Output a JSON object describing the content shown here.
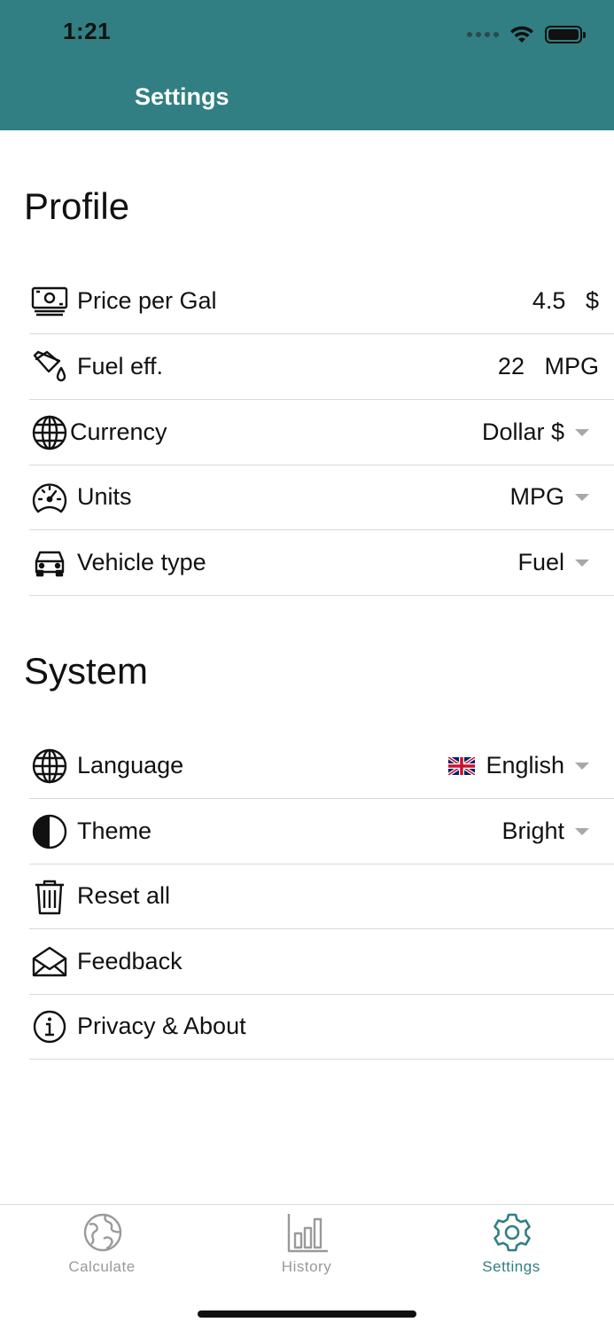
{
  "status_bar": {
    "time": "1:21"
  },
  "header": {
    "title": "Settings",
    "bg_color": "#317F82"
  },
  "profile": {
    "title": "Profile",
    "rows": [
      {
        "icon": "money-icon",
        "label": "Price per Gal",
        "value": "4.5",
        "unit": "$"
      },
      {
        "icon": "fuel-can-icon",
        "label": "Fuel eff.",
        "value": "22",
        "unit": "MPG"
      },
      {
        "icon": "globe-icon",
        "label": "Currency",
        "selected": "Dollar $"
      },
      {
        "icon": "speedometer-icon",
        "label": "Units",
        "selected": "MPG"
      },
      {
        "icon": "car-icon",
        "label": "Vehicle type",
        "selected": "Fuel"
      }
    ]
  },
  "system": {
    "title": "System",
    "rows": [
      {
        "icon": "globe-icon",
        "label": "Language",
        "flag": "uk-flag-icon",
        "selected": "English"
      },
      {
        "icon": "half-circle-icon",
        "label": "Theme",
        "selected": "Bright"
      },
      {
        "icon": "trash-icon",
        "label": "Reset all"
      },
      {
        "icon": "envelope-icon",
        "label": "Feedback"
      },
      {
        "icon": "info-icon",
        "label": "Privacy & About"
      }
    ]
  },
  "tabs": [
    {
      "icon": "earth-icon",
      "label": "Calculate",
      "active": false
    },
    {
      "icon": "bar-chart-icon",
      "label": "History",
      "active": false
    },
    {
      "icon": "gear-icon",
      "label": "Settings",
      "active": true
    }
  ],
  "colors": {
    "accent": "#317F82",
    "inactive_tab": "#9a9a9a",
    "divider": "#d9d9d9",
    "caret": "#a8a8a8"
  }
}
